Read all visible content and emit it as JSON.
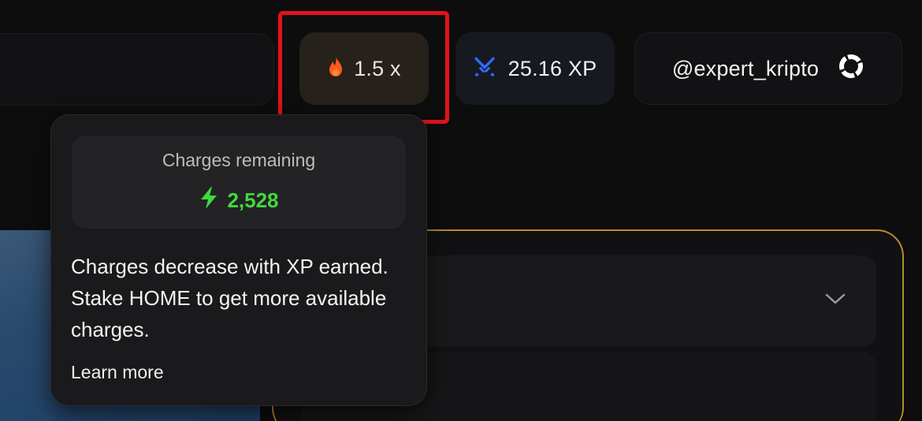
{
  "header": {
    "multiplier": {
      "icon": "flame-icon",
      "label": "1.5 x",
      "color": "#ff5a1f"
    },
    "xp": {
      "icon": "crossed-swords-icon",
      "label": "25.16 XP",
      "color": "#2f6bff"
    },
    "user": {
      "handle": "@expert_kripto",
      "icon": "loading-ring-icon"
    }
  },
  "highlight": {
    "color": "#e3131a"
  },
  "tooltip": {
    "charges_title": "Charges remaining",
    "charges_icon": "lightning-bolt-icon",
    "charges_value": "2,528",
    "charges_color": "#41d93e",
    "description": "Charges decrease with XP earned. Stake HOME to get more available charges.",
    "link": "Learn more"
  },
  "card": {
    "border_color": "#b88b2c",
    "dropdown_icon": "chevron-down-icon"
  }
}
